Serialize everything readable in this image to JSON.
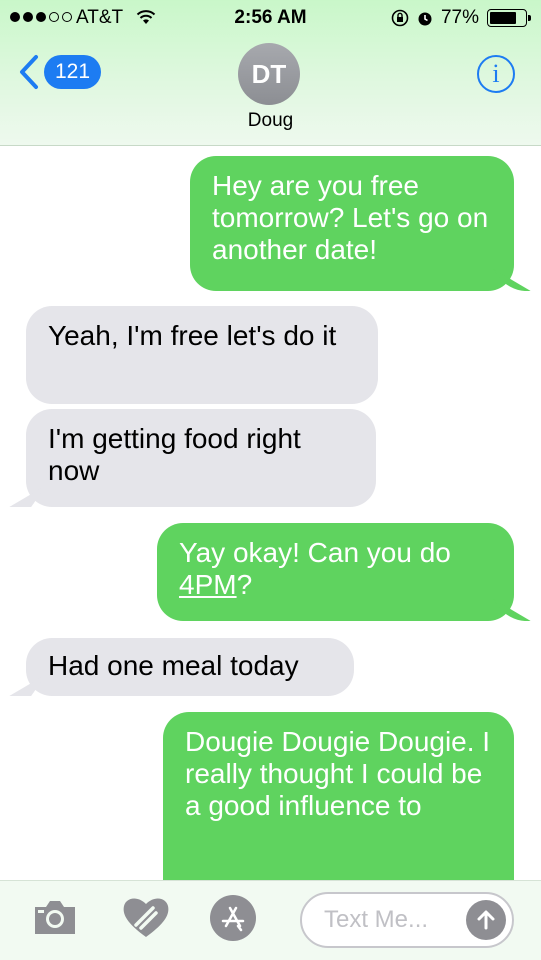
{
  "status_bar": {
    "carrier": "AT&T",
    "time": "2:56 AM",
    "battery_percent": "77%",
    "battery_level": 0.77,
    "signal_bars": 3
  },
  "nav": {
    "back_count": "121",
    "avatar_initials": "DT",
    "contact_name": "Doug",
    "info_glyph": "i"
  },
  "messages": [
    {
      "from": "me",
      "text": "Hey are you free tomorrow? Let's go on another date!"
    },
    {
      "from": "them",
      "text": "Yeah, I'm free let's do it"
    },
    {
      "from": "them",
      "text": "I'm getting food right now"
    },
    {
      "from": "me",
      "text_before": "Yay okay! Can you do ",
      "link": "4PM",
      "text_after": "?"
    },
    {
      "from": "them",
      "text": "Had one meal today"
    },
    {
      "from": "me",
      "text": "Dougie Dougie Dougie. I really thought I could be a good influence to"
    }
  ],
  "input": {
    "placeholder": "Text Me..."
  },
  "icons": {
    "camera": "camera-icon",
    "digital_touch": "digital-touch-heart-icon",
    "app_store": "app-store-icon",
    "send": "send-arrow-icon"
  },
  "colors": {
    "sent_bubble": "#5fd35f",
    "received_bubble": "#e5e5ea",
    "accent": "#1d7cf2"
  }
}
